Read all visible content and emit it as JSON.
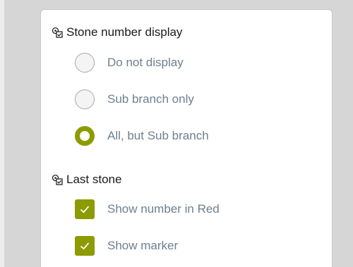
{
  "colors": {
    "accent": "#8c9b00",
    "label_text": "#6e7f8f",
    "header_text": "#1a1a1a",
    "background": "#d6d6d6",
    "panel": "#ffffff"
  },
  "stone_number_display": {
    "title": "Stone number display",
    "icon": "settings-checklist-icon",
    "options": [
      {
        "label": "Do not display",
        "selected": false
      },
      {
        "label": "Sub branch only",
        "selected": false
      },
      {
        "label": "All, but Sub branch",
        "selected": true
      }
    ]
  },
  "last_stone": {
    "title": "Last stone",
    "icon": "settings-checklist-icon",
    "options": [
      {
        "label": "Show number in Red",
        "checked": true
      },
      {
        "label": "Show marker",
        "checked": true
      }
    ]
  }
}
